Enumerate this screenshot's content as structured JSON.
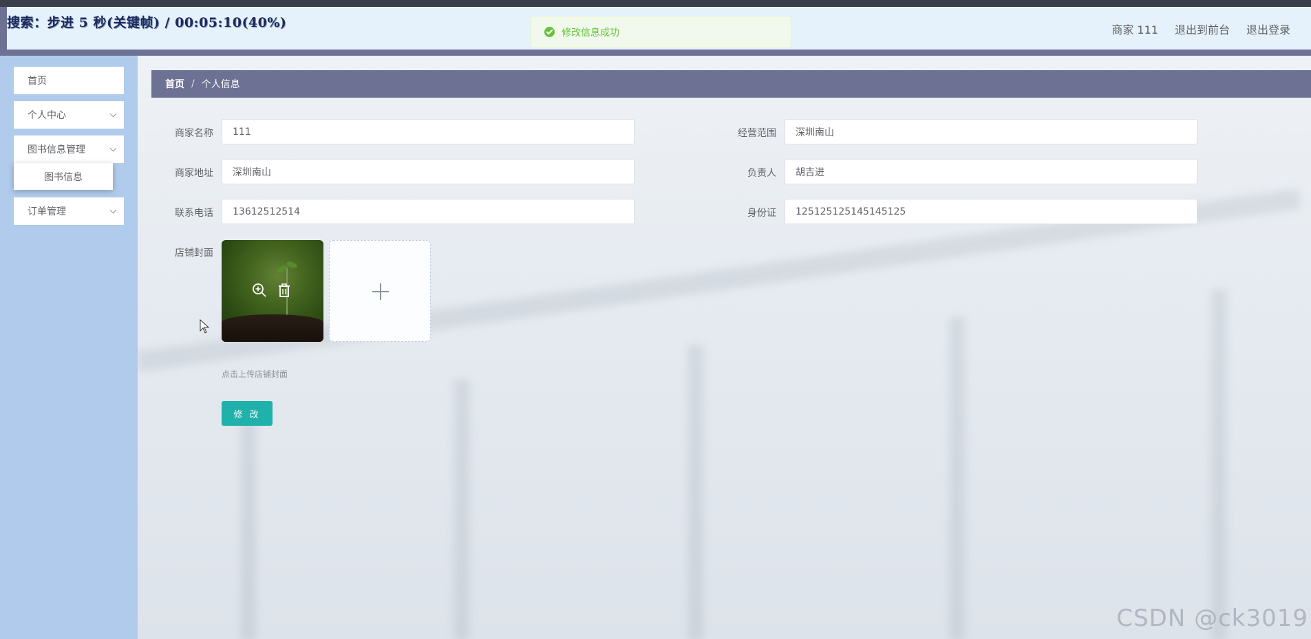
{
  "overlay_caption": "搜索：步进 5 秒(关键帧) / 00:05:10(40%)",
  "toast": {
    "message": "修改信息成功",
    "icon": "check-circle-icon",
    "color": "#67c23a"
  },
  "header": {
    "links": [
      "商家 111",
      "退出到前台",
      "退出登录"
    ]
  },
  "sidebar": {
    "items": [
      {
        "label": "首页",
        "has_children": false
      },
      {
        "label": "个人中心",
        "has_children": true
      },
      {
        "label": "图书信息管理",
        "has_children": true
      },
      {
        "label": "订单管理",
        "has_children": true
      }
    ],
    "submenu": {
      "label": "图书信息"
    }
  },
  "breadcrumb": {
    "home": "首页",
    "separator": "/",
    "current": "个人信息"
  },
  "form": {
    "fields": {
      "merchant_name": {
        "label": "商家名称",
        "value": "111"
      },
      "business_scope": {
        "label": "经营范围",
        "value": "深圳南山"
      },
      "merchant_address": {
        "label": "商家地址",
        "value": "深圳南山"
      },
      "manager": {
        "label": "负责人",
        "value": "胡吉进"
      },
      "phone": {
        "label": "联系电话",
        "value": "13612512514"
      },
      "id_card": {
        "label": "身份证",
        "value": "125125125145145125"
      }
    },
    "cover": {
      "label": "店铺封面",
      "tip": "点击上传店铺封面",
      "icons": [
        "zoom-in-icon",
        "delete-icon",
        "plus-icon"
      ]
    },
    "submit_label": "修 改"
  },
  "watermark": "CSDN @ck3019",
  "colors": {
    "header_accent": "#6d7194",
    "sidebar_bg": "#b0cbec",
    "button": "#20b2aa"
  }
}
